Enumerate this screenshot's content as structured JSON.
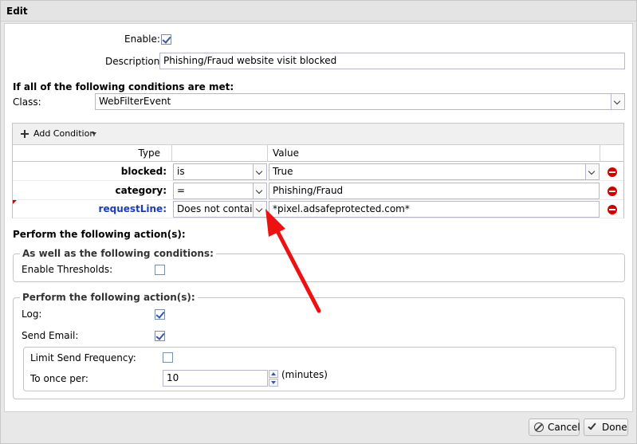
{
  "window": {
    "title": "Edit"
  },
  "form": {
    "enable_label": "Enable:",
    "enable_checked": true,
    "description_label": "Description:",
    "description_value": "Phishing/Fraud website visit blocked"
  },
  "conditions": {
    "heading": "If all of the following conditions are met:",
    "class_label": "Class:",
    "class_value": "WebFilterEvent",
    "add_condition_label": "Add Condition",
    "columns": {
      "type": "Type",
      "value": "Value"
    },
    "rows": [
      {
        "type": "blocked:",
        "operator": "is",
        "value": "True",
        "value_is_combo": true,
        "highlight": false
      },
      {
        "type": "category:",
        "operator": "=",
        "value": "Phishing/Fraud",
        "value_is_combo": false,
        "highlight": false
      },
      {
        "type": "requestLine:",
        "operator": "Does not contain",
        "value": "*pixel.adsafeprotected.com*",
        "value_is_combo": false,
        "highlight": true
      }
    ]
  },
  "actions": {
    "heading": "Perform the following action(s):",
    "conditions_fieldset": {
      "legend": "As well as the following conditions:",
      "enable_thresholds_label": "Enable Thresholds:",
      "enable_thresholds_checked": false
    },
    "actions_fieldset": {
      "legend": "Perform the following action(s):",
      "log_label": "Log:",
      "log_checked": true,
      "send_email_label": "Send Email:",
      "send_email_checked": true,
      "limit_frequency_label": "Limit Send Frequency:",
      "limit_frequency_checked": false,
      "once_per_label": "To once per:",
      "once_per_value": "10",
      "once_per_unit": "(minutes)"
    }
  },
  "footer": {
    "cancel_label": "Cancel",
    "done_label": "Done"
  },
  "colors": {
    "accent_blue": "#1a3dbf",
    "remove_red": "#d40000",
    "arrow_red": "#ee1111"
  },
  "icons": [
    "plus-icon",
    "chevron-down-icon",
    "remove-icon",
    "check-icon",
    "cancel-icon",
    "done-icon",
    "spinner-up-icon",
    "spinner-down-icon",
    "annotation-arrow"
  ]
}
